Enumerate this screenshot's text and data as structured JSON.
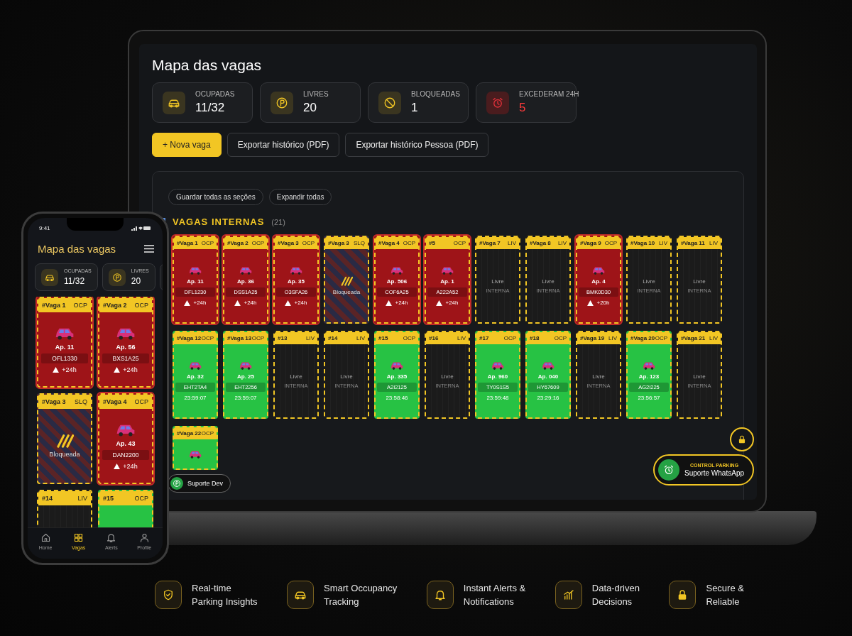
{
  "laptop": {
    "title": "Mapa das vagas",
    "stats": [
      {
        "kind": "car",
        "label": "OCUPADAS",
        "value": "11/32"
      },
      {
        "kind": "parking",
        "label": "LIVRES",
        "value": "20"
      },
      {
        "kind": "blocked",
        "label": "BLOQUEADAS",
        "value": "1"
      },
      {
        "kind": "alarm",
        "label": "EXCEDERAM 24H",
        "value": "5"
      }
    ],
    "buttons": [
      {
        "label": "+ Nova vaga",
        "primary": true
      },
      {
        "label": "Exportar histórico (PDF)",
        "primary": false
      },
      {
        "label": "Exportar histórico Pessoa (PDF)",
        "primary": false
      }
    ],
    "section_buttons": [
      "Guardar todas as seções",
      "Expandir todas"
    ],
    "section": {
      "title": "VAGAS INTERNAS",
      "count": "(21)"
    },
    "slots": [
      {
        "label": "#Vaga 1",
        "code": "OCP",
        "kind": "overdue",
        "apartment": "Ap. 11",
        "plate": "DFL1230",
        "note": "+24h"
      },
      {
        "label": "#Vaga 2",
        "code": "OCP",
        "kind": "overdue",
        "apartment": "Ap. 36",
        "plate": "DSS1A25",
        "note": "+24h"
      },
      {
        "label": "#Vaga 3",
        "code": "OCP",
        "kind": "overdue",
        "apartment": "Ap. 35",
        "plate": "O3SFA26",
        "note": "+24h"
      },
      {
        "label": "#Vaga 3",
        "code": "SLQ",
        "kind": "blocked",
        "text": "Bloqueada"
      },
      {
        "label": "#Vaga 4",
        "code": "OCP",
        "kind": "overdue",
        "apartment": "Ap. 506",
        "plate": "COF6A25",
        "note": "+24h"
      },
      {
        "label": "#5",
        "code": "OCP",
        "kind": "overdue",
        "apartment": "Ap. 1",
        "plate": "A222A52",
        "note": "+24h"
      },
      {
        "label": "#Vaga 7",
        "code": "LIV",
        "kind": "free",
        "text": "Livre",
        "area": "INTERNA"
      },
      {
        "label": "#Vaga 8",
        "code": "LIV",
        "kind": "free",
        "text": "Livre",
        "area": "INTERNA"
      },
      {
        "label": "#Vaga 9",
        "code": "OCP",
        "kind": "overdue",
        "apartment": "Ap. 4",
        "plate": "BMK0D30",
        "note": "+20h"
      },
      {
        "label": "#Vaga 10",
        "code": "LIV",
        "kind": "free",
        "text": "Livre",
        "area": "INTERNA"
      },
      {
        "label": "#Vaga 11",
        "code": "LIV",
        "kind": "free",
        "text": "Livre",
        "area": "INTERNA"
      },
      {
        "label": "#Vaga 12",
        "code": "OCP",
        "kind": "occupied",
        "apartment": "Ap. 32",
        "plate": "EHT2TA4",
        "timer": "23:59:07"
      },
      {
        "label": "#Vaga 13",
        "code": "OCP",
        "kind": "occupied",
        "apartment": "Ap. 25",
        "plate": "EHT2256",
        "timer": "23:59:07"
      },
      {
        "label": "#13",
        "code": "LIV",
        "kind": "free",
        "text": "Livre",
        "area": "INTERNA"
      },
      {
        "label": "#14",
        "code": "LIV",
        "kind": "free",
        "text": "Livre",
        "area": "INTERNA"
      },
      {
        "label": "#15",
        "code": "OCP",
        "kind": "occupied",
        "apartment": "Ap. 335",
        "plate": "A2I2125",
        "timer": "23:58:46"
      },
      {
        "label": "#16",
        "code": "LIV",
        "kind": "free",
        "text": "Livre",
        "area": "INTERNA"
      },
      {
        "label": "#17",
        "code": "OCP",
        "kind": "occupied",
        "apartment": "Ap. 960",
        "plate": "TY0S1S5",
        "timer": "23:59:48"
      },
      {
        "label": "#18",
        "code": "OCP",
        "kind": "occupied",
        "apartment": "Ap. 040",
        "plate": "HY67609",
        "timer": "23:29:16"
      },
      {
        "label": "#Vaga 19",
        "code": "LIV",
        "kind": "free",
        "text": "Livre",
        "area": "INTERNA"
      },
      {
        "label": "#Vaga 20",
        "code": "OCP",
        "kind": "occupied",
        "apartment": "Ap. 123",
        "plate": "AG2I225",
        "timer": "23:56:57"
      },
      {
        "label": "#Vaga 21",
        "code": "LIV",
        "kind": "free",
        "text": "Livre",
        "area": "INTERNA"
      },
      {
        "label": "#Vaga 22",
        "code": "OCP",
        "kind": "occupied"
      }
    ],
    "support_dev": "Suporte Dev",
    "whatsapp": {
      "caption": "CONTROL PARKING",
      "label": "Suporte WhatsApp"
    }
  },
  "phone": {
    "time": "9:41",
    "title": "Mapa das vagas",
    "stats": [
      {
        "kind": "car",
        "label": "OCUPADAS",
        "value": "11/32"
      },
      {
        "kind": "parking",
        "label": "LIVRES",
        "value": "20"
      },
      {
        "kind": "blocked"
      }
    ],
    "slots": [
      {
        "label": "#Vaga 1",
        "code": "OCP",
        "kind": "overdue",
        "apartment": "Ap. 11",
        "plate": "OFL1330",
        "note": "+24h"
      },
      {
        "label": "#Vaga 2",
        "code": "OCP",
        "kind": "overdue",
        "apartment": "Ap. 56",
        "plate": "BXS1A25",
        "note": "+24h"
      },
      {
        "label": "#Vaga 3",
        "code": "SLQ",
        "kind": "blocked",
        "text": "Bloqueada"
      },
      {
        "label": "#Vaga 4",
        "code": "OCP",
        "kind": "overdue",
        "apartment": "Ap. 43",
        "plate": "DAN2200",
        "note": "+24h"
      },
      {
        "label": "#14",
        "code": "LIV",
        "kind": "free"
      },
      {
        "label": "#15",
        "code": "OCP",
        "kind": "occupied"
      }
    ],
    "nav": [
      {
        "kind": "home",
        "label": "Home",
        "selected": false
      },
      {
        "kind": "grid",
        "label": "Vagas",
        "selected": true
      },
      {
        "kind": "bell",
        "label": "Alerts",
        "selected": false
      },
      {
        "kind": "user",
        "label": "Profile",
        "selected": false
      }
    ]
  },
  "features": [
    {
      "kind": "shield",
      "lines": [
        "Real-time",
        "Parking Insights"
      ]
    },
    {
      "kind": "car",
      "lines": [
        "Smart Occupancy",
        "Tracking"
      ]
    },
    {
      "kind": "bell",
      "lines": [
        "Instant Alerts &",
        "Notifications"
      ]
    },
    {
      "kind": "chart",
      "lines": [
        "Data-driven",
        "Decisions"
      ]
    },
    {
      "kind": "lock",
      "lines": [
        "Secure &",
        "Reliable"
      ]
    }
  ]
}
